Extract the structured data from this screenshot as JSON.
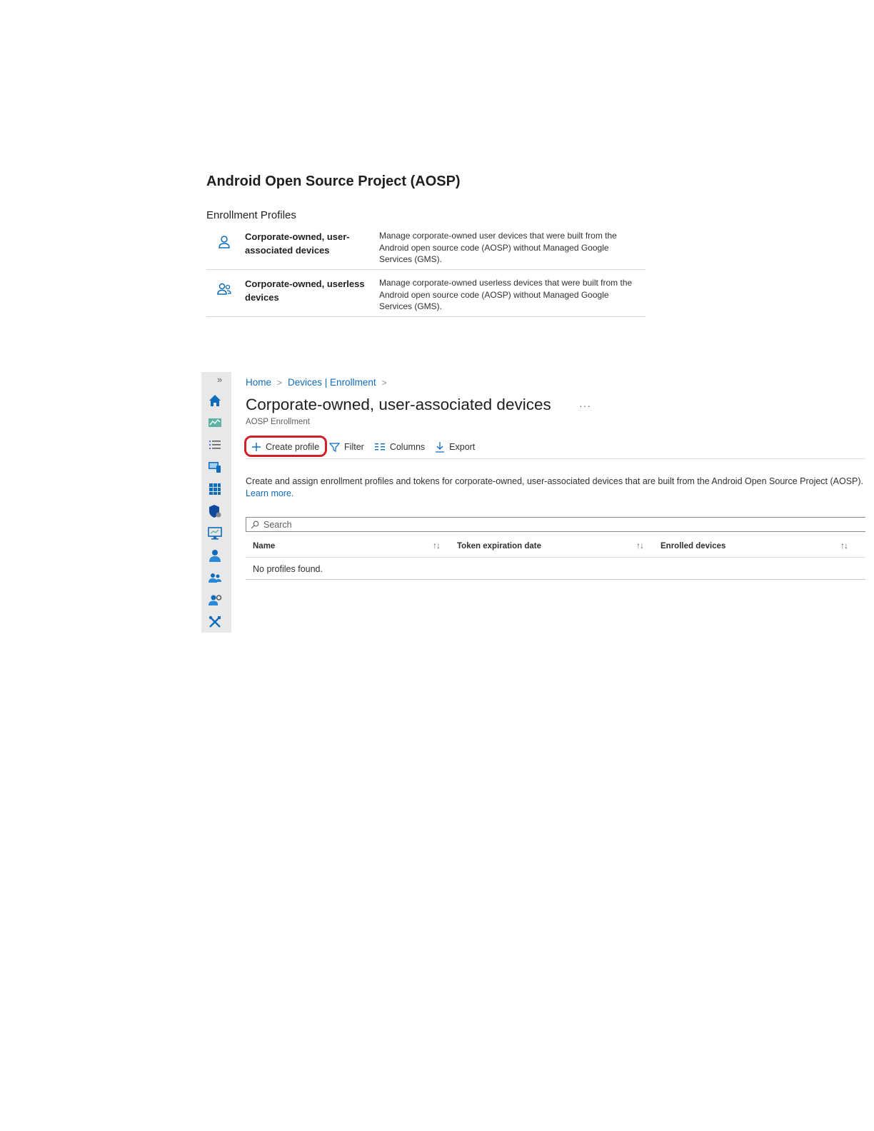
{
  "doc": {
    "section_title": "Android Open Source Project (AOSP)",
    "section_label": "Enrollment Profiles",
    "profiles": [
      {
        "icon": "person-icon",
        "name": "Corporate-owned, user-associated devices",
        "description": "Manage corporate-owned user devices that were built from the Android open source code (AOSP) without Managed Google Services (GMS)."
      },
      {
        "icon": "people-icon",
        "name": "Corporate-owned, userless devices",
        "description": "Manage corporate-owned userless devices that were built from the Android open source code (AOSP) without Managed Google Services (GMS)."
      }
    ]
  },
  "portal": {
    "rail": {
      "expand": "»",
      "icons": [
        "home-icon",
        "dashboard-icon",
        "all-services-icon",
        "devices-icon",
        "apps-icon",
        "endpoint-security-icon",
        "reports-icon",
        "users-icon",
        "groups-icon",
        "tenant-admin-icon",
        "troubleshooting-icon"
      ]
    },
    "breadcrumb": {
      "home": "Home",
      "devices": "Devices | Enrollment",
      "separator": ">"
    },
    "title": "Corporate-owned, user-associated devices",
    "more": "···",
    "subtitle": "AOSP Enrollment",
    "toolbar": {
      "create": "Create profile",
      "filter": "Filter",
      "columns": "Columns",
      "export": "Export"
    },
    "intro": "Create and assign enrollment profiles and tokens for corporate-owned, user-associated devices that are built from the Android Open Source Project (AOSP).",
    "learn_more": "Learn more.",
    "search_placeholder": "Search",
    "grid": {
      "columns": [
        "Name",
        "Token expiration date",
        "Enrolled devices"
      ],
      "sort_glyph": "↑↓",
      "empty": "No profiles found."
    },
    "colors": {
      "accent": "#0f6cbd",
      "highlight": "#d32027",
      "rail_bg": "#e8e8e8"
    }
  }
}
